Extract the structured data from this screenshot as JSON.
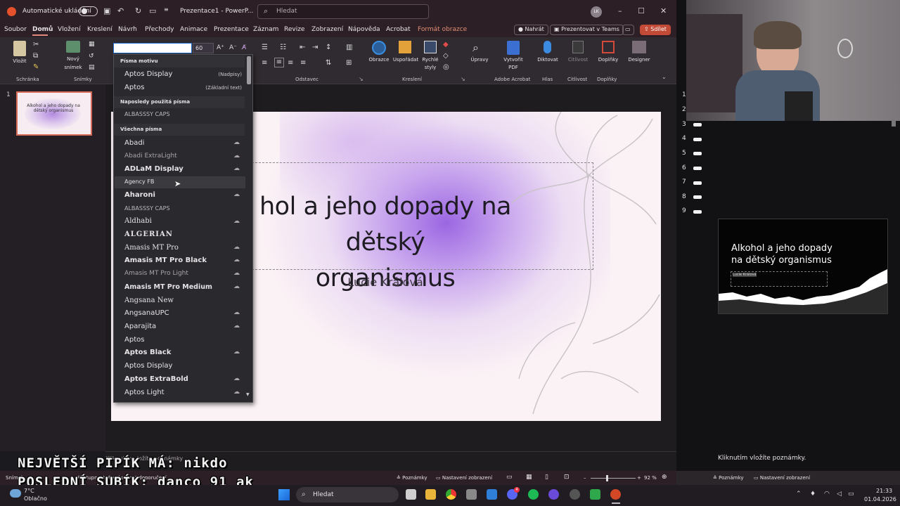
{
  "titlebar": {
    "autosave_label": "Automatické ukládání",
    "doc_title": "Prezentace1 - PowerP...",
    "search_placeholder": "Hledat",
    "avatar_initials": "LK"
  },
  "menu": {
    "tabs": [
      "Soubor",
      "Domů",
      "Vložení",
      "Kreslení",
      "Návrh",
      "Přechody",
      "Animace",
      "Prezentace",
      "Záznam",
      "Revize",
      "Zobrazení",
      "Nápověda",
      "Acrobat",
      "Formát obrazce"
    ],
    "active_tab": "Domů",
    "record_label": "Nahrát",
    "teams_label": "Prezentovat v Teams",
    "share_label": "Sdílet"
  },
  "ribbon": {
    "paste_label": "Vložit",
    "new_slide_label1": "Nový",
    "new_slide_label2": "snímek",
    "font_size": "60",
    "groups": {
      "clipboard": "Schránka",
      "slides": "Snímky",
      "paragraph": "Odstavec",
      "drawing": "Kreslení",
      "adobe": "Adobe Acrobat",
      "voice": "Hlas",
      "sensitivity": "Citlivost",
      "addins": "Doplňky"
    },
    "buttons": {
      "shapes": "Obrazce",
      "arrange": "Uspořádat",
      "quick_styles1": "Rychlé",
      "quick_styles2": "styly",
      "editing": "Úpravy",
      "create_pdf1": "Vytvořit",
      "create_pdf2": "PDF",
      "dictate": "Diktovat",
      "sensitivity": "Citlivost",
      "addins": "Doplňky",
      "designer": "Designer"
    }
  },
  "font_dropdown": {
    "theme_header": "Písma motivu",
    "theme_fonts": [
      {
        "name": "Aptos Display",
        "note": "(Nadpisy)"
      },
      {
        "name": "Aptos",
        "note": "(Základní text)"
      }
    ],
    "recent_header": "Naposledy použitá písma",
    "recent_fonts": [
      "ALBASSSY CAPS"
    ],
    "all_header": "Všechna písma",
    "all_fonts": [
      "Abadi",
      "Abadi ExtraLight",
      "ADLaM Display",
      "Agency FB",
      "Aharoni",
      "ALBASSSY CAPS",
      "Aldhabi",
      "ALGERIAN",
      "Amasis MT Pro",
      "Amasis MT Pro Black",
      "Amasis MT Pro Light",
      "Amasis MT Pro Medium",
      "Angsana New",
      "AngsanaUPC",
      "Aparajita",
      "Aptos",
      "Aptos Black",
      "Aptos Display",
      "Aptos ExtraBold",
      "Aptos Light"
    ],
    "cloud_icon": "cloud-download-icon"
  },
  "slide": {
    "title": "Alkohol a jeho dopady na dětský organismus",
    "title_visible_line1": "hol a jeho dopady na dětský",
    "title_visible_line2": "organismus",
    "subtitle": "Lucie Králová",
    "thumb_number": "1",
    "thumb_title": "Alkohol a jeho dopady na dětský organismus"
  },
  "notes_placeholder": "Kliknutím vložíte poznámky",
  "statusbar": {
    "slide_label": "Snímek",
    "accessibility": "Přístupnost: Prozkoumat doporučení",
    "notes_btn": "Poznámky",
    "display_settings": "Nastavení zobrazení",
    "zoom": "92 %"
  },
  "presenter": {
    "slide_numbers": [
      "1",
      "2",
      "3",
      "4",
      "5",
      "6",
      "7",
      "8",
      "9"
    ],
    "preview_title_line1": "Alkohol a jeho dopady",
    "preview_title_line2": "na dětský organismus",
    "preview_subtitle": "Lucie Králová",
    "notes": "Kliknutím vložíte poznámky.",
    "notes_btn": "Poznámky",
    "display_settings": "Nastavení zobrazení"
  },
  "overlay": {
    "line1": "NEJVĚTŠÍ PIPÍK MÁ: nikdo",
    "line2": "POSLEDNÍ SUBÍK: danco_91_ak"
  },
  "taskbar": {
    "temperature": "7°C",
    "weather": "Oblačno",
    "search": "Hledat",
    "time": "21:33",
    "date": "01.04.2026",
    "notification_badge": "4"
  }
}
